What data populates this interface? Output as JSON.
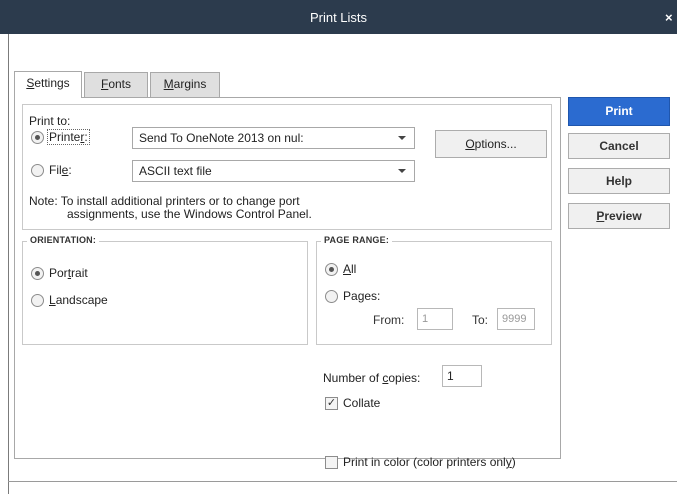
{
  "window": {
    "title": "Print Lists",
    "close_glyph": "×"
  },
  "tabs": [
    {
      "pre": "",
      "key": "S",
      "post": "ettings"
    },
    {
      "pre": "",
      "key": "F",
      "post": "onts"
    },
    {
      "pre": "",
      "key": "M",
      "post": "argins"
    }
  ],
  "print_to": {
    "label": "Print to:",
    "printer": {
      "pre": "Printe",
      "key": "r",
      "post": ":",
      "selected": true,
      "value": "Send To OneNote 2013 on nul:"
    },
    "file": {
      "pre": "Fil",
      "key": "e",
      "post": ":",
      "selected": false,
      "value": "ASCII text file"
    },
    "options_button": {
      "pre": "",
      "key": "O",
      "post": "ptions..."
    },
    "note_line1": "Note: To install additional printers or to change port",
    "note_line2": "assignments, use the Windows Control Panel."
  },
  "orientation": {
    "title": "ORIENTATION:",
    "portrait": {
      "pre": "Por",
      "key": "t",
      "post": "rait",
      "selected": true
    },
    "landscape": {
      "pre": "",
      "key": "L",
      "post": "andscape",
      "selected": false
    }
  },
  "page_range": {
    "title": "PAGE RANGE:",
    "all": {
      "pre": "",
      "key": "A",
      "post": "ll",
      "selected": true
    },
    "pages": {
      "pre": "Pa",
      "key": "g",
      "post": "es:",
      "selected": false
    },
    "from_label": "From:",
    "from_value": "1",
    "to_label": "To:",
    "to_value": "9999"
  },
  "copies": {
    "pre": "Number of ",
    "key": "c",
    "post": "opies:",
    "value": "1"
  },
  "collate": {
    "label": "Collate",
    "checked": true
  },
  "color": {
    "pre": "Print in color (color printers onl",
    "key": "y",
    "post": ")",
    "checked": false
  },
  "buttons": {
    "print": "Print",
    "cancel": "Cancel",
    "help": "Help",
    "preview": {
      "pre": "",
      "key": "P",
      "post": "review"
    }
  }
}
